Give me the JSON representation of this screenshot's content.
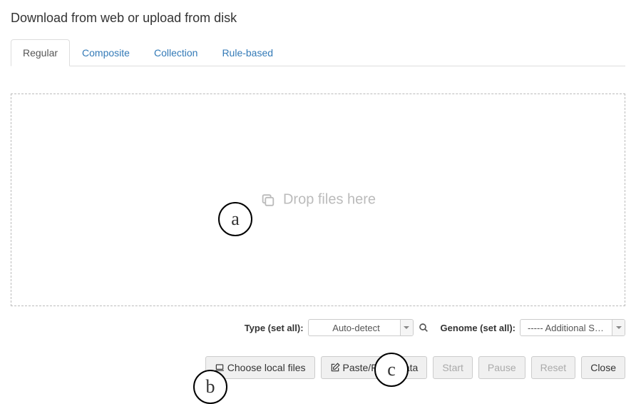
{
  "page": {
    "title": "Download from web or upload from disk"
  },
  "tabs": {
    "regular": "Regular",
    "composite": "Composite",
    "collection": "Collection",
    "rulebased": "Rule-based"
  },
  "drop": {
    "text": "Drop files here"
  },
  "controls": {
    "type_label": "Type (set all):",
    "type_value": "Auto-detect",
    "genome_label": "Genome (set all):",
    "genome_value": "----- Additional S…"
  },
  "buttons": {
    "choose": "Choose local files",
    "paste": "Paste/Fetch data",
    "start": "Start",
    "pause": "Pause",
    "reset": "Reset",
    "close": "Close"
  },
  "annotations": {
    "a": "a",
    "b": "b",
    "c": "c"
  }
}
